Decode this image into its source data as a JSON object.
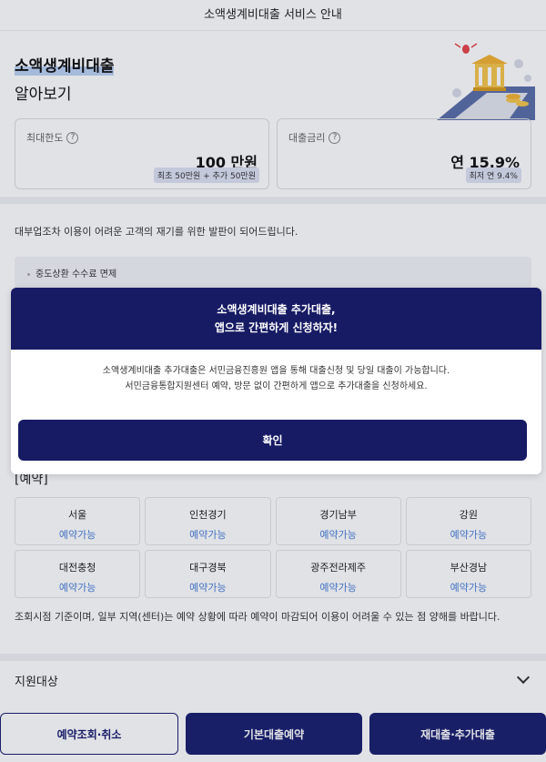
{
  "header": {
    "title": "소액생계비대출 서비스 안내"
  },
  "hero": {
    "title_line1": "소액생계비대출",
    "title_line2": "알아보기",
    "illustration_icon": "bank-building-icon"
  },
  "cards": [
    {
      "label": "최대한도",
      "value": "100 만원",
      "badge": "최초 50만원 + 추가 50만원"
    },
    {
      "label": "대출금리",
      "value": "연 15.9%",
      "badge": "최저 연 9.4%"
    }
  ],
  "description": {
    "text": "대부업조차 이용이 어려운 고객의 재기를 위한 발판이 되어드립니다.",
    "benefit": "중도상환 수수료 면제"
  },
  "reservation": {
    "title": "[예약]",
    "regions": [
      {
        "name": "서울",
        "status": "예약가능"
      },
      {
        "name": "인천경기",
        "status": "예약가능"
      },
      {
        "name": "경기남부",
        "status": "예약가능"
      },
      {
        "name": "강원",
        "status": "예약가능"
      },
      {
        "name": "대전충청",
        "status": "예약가능"
      },
      {
        "name": "대구경북",
        "status": "예약가능"
      },
      {
        "name": "광주전라제주",
        "status": "예약가능"
      },
      {
        "name": "부산경남",
        "status": "예약가능"
      }
    ],
    "note": "조회시점 기준이며, 일부 지역(센터)는 예약 상황에 따라 예약이 마감되어 이용이 어려울 수 있는 점 양해를 바랍니다."
  },
  "support": {
    "label": "지원대상"
  },
  "bottom_buttons": {
    "inquiry": "예약조회·취소",
    "basic": "기본대출예약",
    "reloan": "재대출·추가대출"
  },
  "modal": {
    "title_line1": "소액생계비대출 추가대출,",
    "title_line2": "앱으로 간편하게 신청하자!",
    "body_line1": "소액생계비대출 추가대출은 서민금융진흥원 앱을 통해 대출신청 및 당일 대출이 가능합니다.",
    "body_line2": "서민금융통합지원센터 예약, 방문 없이 간편하게 앱으로 추가대출을 신청하세요.",
    "confirm": "확인"
  },
  "colors": {
    "navy": "#171b64",
    "accent_blue": "#4a7fd6",
    "dim": "#191e3c"
  }
}
